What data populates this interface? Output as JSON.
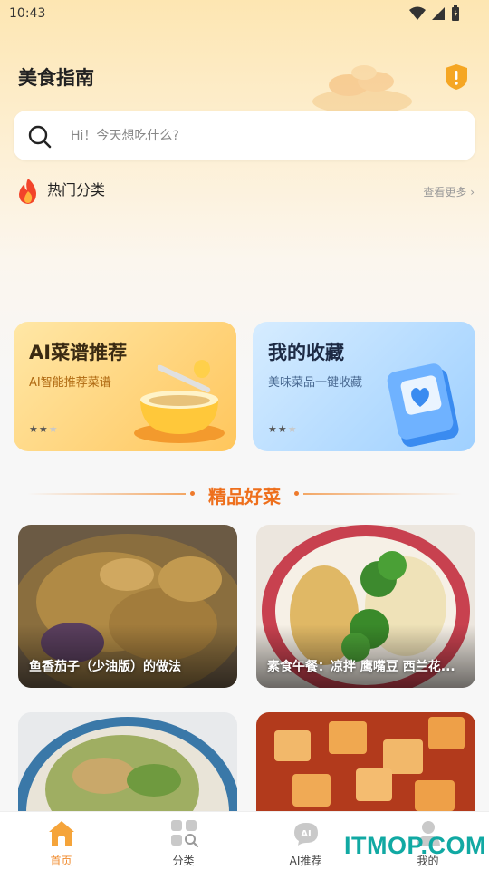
{
  "status_bar": {
    "time": "10:43",
    "icons": [
      "wifi-icon",
      "signal-icon",
      "battery-charging-icon"
    ]
  },
  "header": {
    "title": "美食指南",
    "action_icon": "shield-alert-icon"
  },
  "search": {
    "placeholder": "Hi！今天想吃什么?",
    "icon": "search-icon"
  },
  "hot_categories": {
    "title": "热门分类",
    "more": "查看更多 ›",
    "icon": "fire-icon"
  },
  "feature_cards": [
    {
      "title": "AI菜谱推荐",
      "subtitle": "AI智能推荐菜谱",
      "rating": "★★★",
      "rating_value": 2,
      "rating_max": 3,
      "icon": "soup-bowl-icon"
    },
    {
      "title": "我的收藏",
      "subtitle": "美味菜品一键收藏",
      "rating": "★★★",
      "rating_value": 2,
      "rating_max": 3,
      "icon": "heart-book-icon"
    }
  ],
  "section": {
    "title": "精品好菜"
  },
  "dishes": [
    {
      "title": "鱼香茄子（少油版）的做法"
    },
    {
      "title": "素食午餐：凉拌 鹰嘴豆 西兰花..."
    },
    {
      "title": ""
    },
    {
      "title": ""
    }
  ],
  "tabs": [
    {
      "label": "首页",
      "icon": "home-icon",
      "active": true
    },
    {
      "label": "分类",
      "icon": "category-grid-icon",
      "active": false
    },
    {
      "label": "AI推荐",
      "icon": "ai-robot-icon",
      "active": false
    },
    {
      "label": "我的",
      "icon": "profile-icon",
      "active": false
    }
  ],
  "colors": {
    "accent": "#f08a2c",
    "section_title": "#ee6f1c",
    "watermark": "#11a9a3"
  },
  "watermark": "ITMOP.COM"
}
